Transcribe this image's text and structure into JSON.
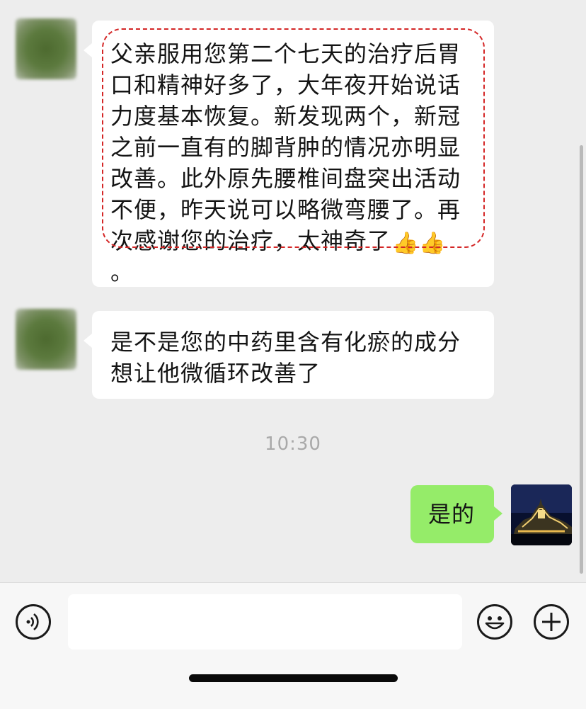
{
  "messages": [
    {
      "sender": "other",
      "text_main": "父亲服用您第二个七天的治疗后胃口和精神好多了，大年夜开始说话力度基本恢复。新发现两个，新冠之前一直有的脚背肿的情况亦明显改善。此外原先腰椎间盘突出活动不便，昨天说可以略微弯腰了。再次感谢您的治疗，太神奇了",
      "emoji": "👍👍",
      "text_tail": "。"
    },
    {
      "sender": "other",
      "text_main": "是不是您的中药里含有化瘀的成分想让他微循环改善了"
    },
    {
      "sender": "self",
      "text_main": "是的"
    }
  ],
  "timestamp": "10:30",
  "input_bar": {
    "value": "",
    "voice_icon": "voice-icon",
    "emoji_icon": "emoji-icon",
    "plus_icon": "plus-icon"
  },
  "colors": {
    "background": "#ededed",
    "bubble_other": "#ffffff",
    "bubble_self": "#95ec69",
    "highlight": "#d42626"
  }
}
